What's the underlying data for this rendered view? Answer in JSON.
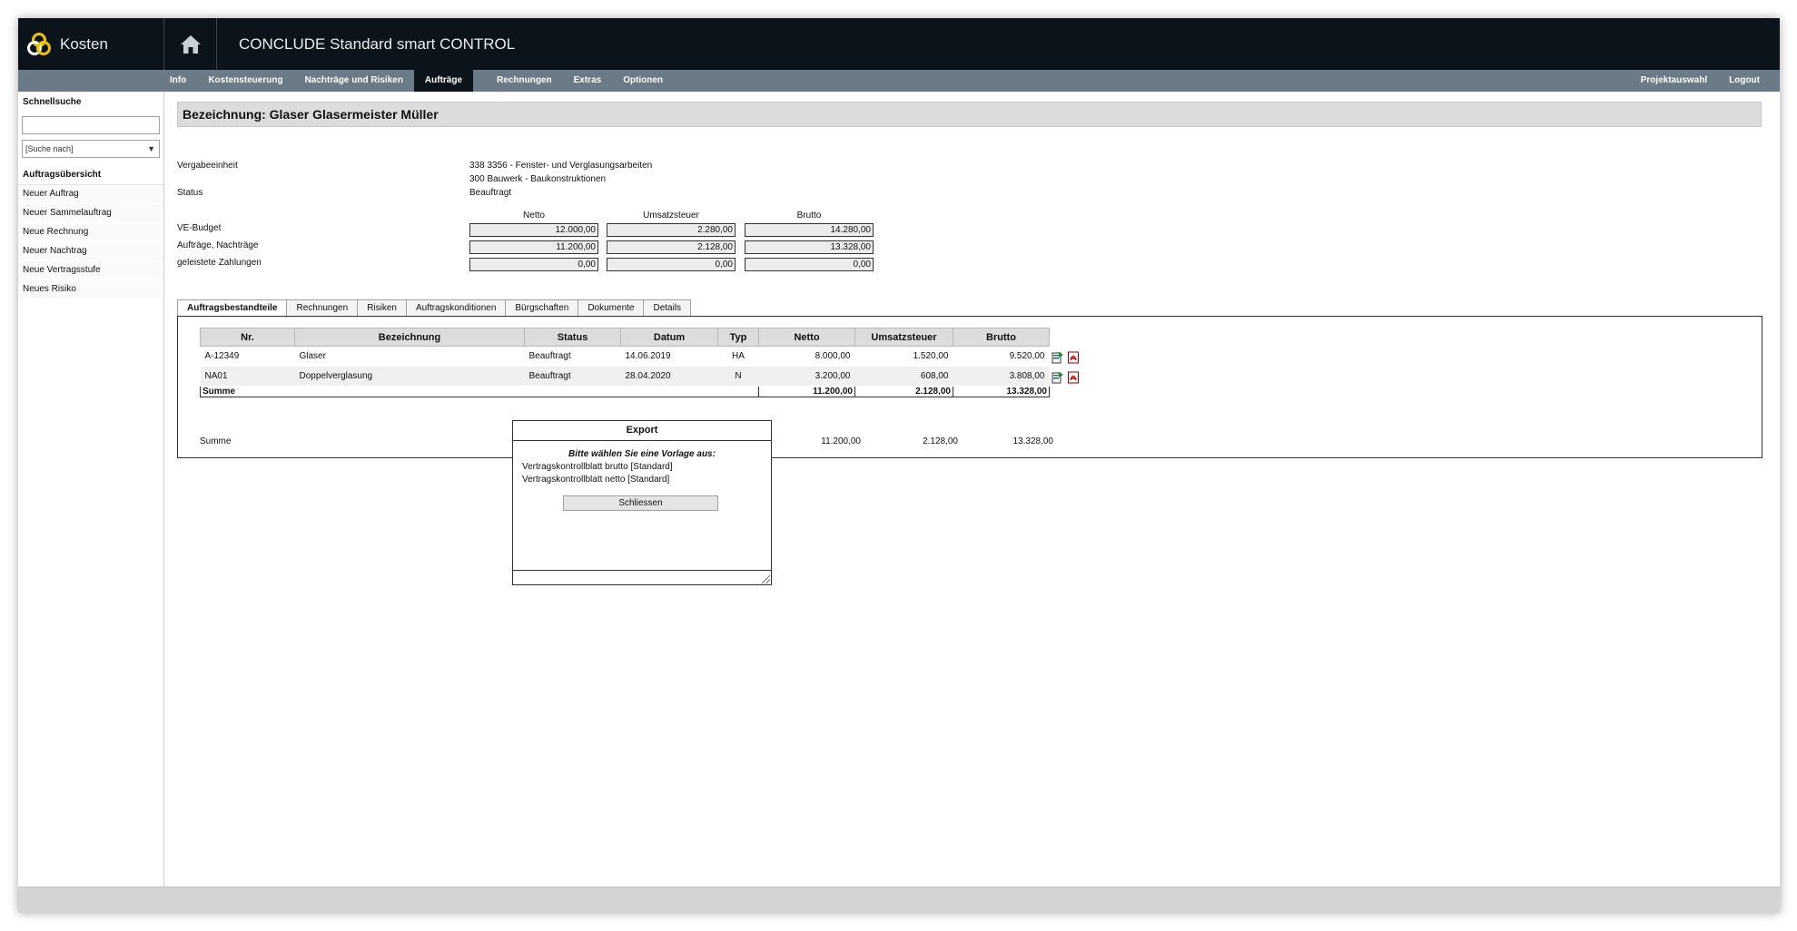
{
  "brand": {
    "app_name": "Kosten"
  },
  "header": {
    "title": "CONCLUDE Standard smart CONTROL"
  },
  "menu": {
    "left": [
      "Info",
      "Kostensteuerung",
      "Nachträge und Risiken",
      "Aufträge",
      "Rechnungen",
      "Extras",
      "Optionen"
    ],
    "active": "Aufträge",
    "right": [
      "Projektauswahl",
      "Logout"
    ]
  },
  "sidebar": {
    "quicksearch_label": "Schnellsuche",
    "search_value": "",
    "select_value": "[Suche nach]",
    "section": "Auftragsübersicht",
    "items": [
      "Neuer Auftrag",
      "Neuer Sammelauftrag",
      "Neue Rechnung",
      "Neuer Nachtrag",
      "Neue Vertragsstufe",
      "Neues Risiko"
    ]
  },
  "main": {
    "heading": "Bezeichnung: Glaser Glasermeister Müller",
    "vergabe_label": "Vergabeeinheit",
    "vergabe_line1": "338 3356 - Fenster- und Verglasungsarbeiten",
    "vergabe_line2": "300 Bauwerk - Baukonstruktionen",
    "status_label": "Status",
    "status_value": "Beauftragt",
    "cols": {
      "netto": "Netto",
      "ust": "Umsatzsteuer",
      "brutto": "Brutto"
    },
    "rows": [
      {
        "label": "VE-Budget",
        "netto": "12.000,00",
        "ust": "2.280,00",
        "brutto": "14.280,00"
      },
      {
        "label": "Aufträge, Nachträge",
        "netto": "11.200,00",
        "ust": "2.128,00",
        "brutto": "13.328,00"
      },
      {
        "label": "geleistete Zahlungen",
        "netto": "0,00",
        "ust": "0,00",
        "brutto": "0,00"
      }
    ]
  },
  "tabs": {
    "items": [
      "Auftragsbestandteile",
      "Rechnungen",
      "Risiken",
      "Auftragskonditionen",
      "Bürgschaften",
      "Dokumente",
      "Details"
    ],
    "active": "Auftragsbestandteile"
  },
  "table": {
    "headers": [
      "Nr.",
      "Bezeichnung",
      "Status",
      "Datum",
      "Typ",
      "Netto",
      "Umsatzsteuer",
      "Brutto"
    ],
    "rows": [
      {
        "nr": "A-12349",
        "bez": "Glaser",
        "status": "Beauftragt",
        "datum": "14.06.2019",
        "typ": "HA",
        "netto": "8.000,00",
        "ust": "1.520,00",
        "brutto": "9.520,00"
      },
      {
        "nr": "NA01",
        "bez": "Doppelverglasung",
        "status": "Beauftragt",
        "datum": "28.04.2020",
        "typ": "N",
        "netto": "3.200,00",
        "ust": "608,00",
        "brutto": "3.808,00"
      }
    ],
    "sum": {
      "label": "Summe",
      "netto": "11.200,00",
      "ust": "2.128,00",
      "brutto": "13.328,00"
    }
  },
  "total": {
    "label": "Summe",
    "netto": "11.200,00",
    "ust": "2.128,00",
    "brutto": "13.328,00"
  },
  "dialog": {
    "title": "Export",
    "prompt": "Bitte wählen Sie eine Vorlage aus:",
    "options": [
      "Vertragskontrollblatt brutto [Standard]",
      "Vertragskontrollblatt netto [Standard]"
    ],
    "close_label": "Schliessen"
  },
  "colors": {
    "topbar": "#0b141b",
    "menubar": "#6a7a86",
    "heading_bg": "#dcdcdc"
  }
}
